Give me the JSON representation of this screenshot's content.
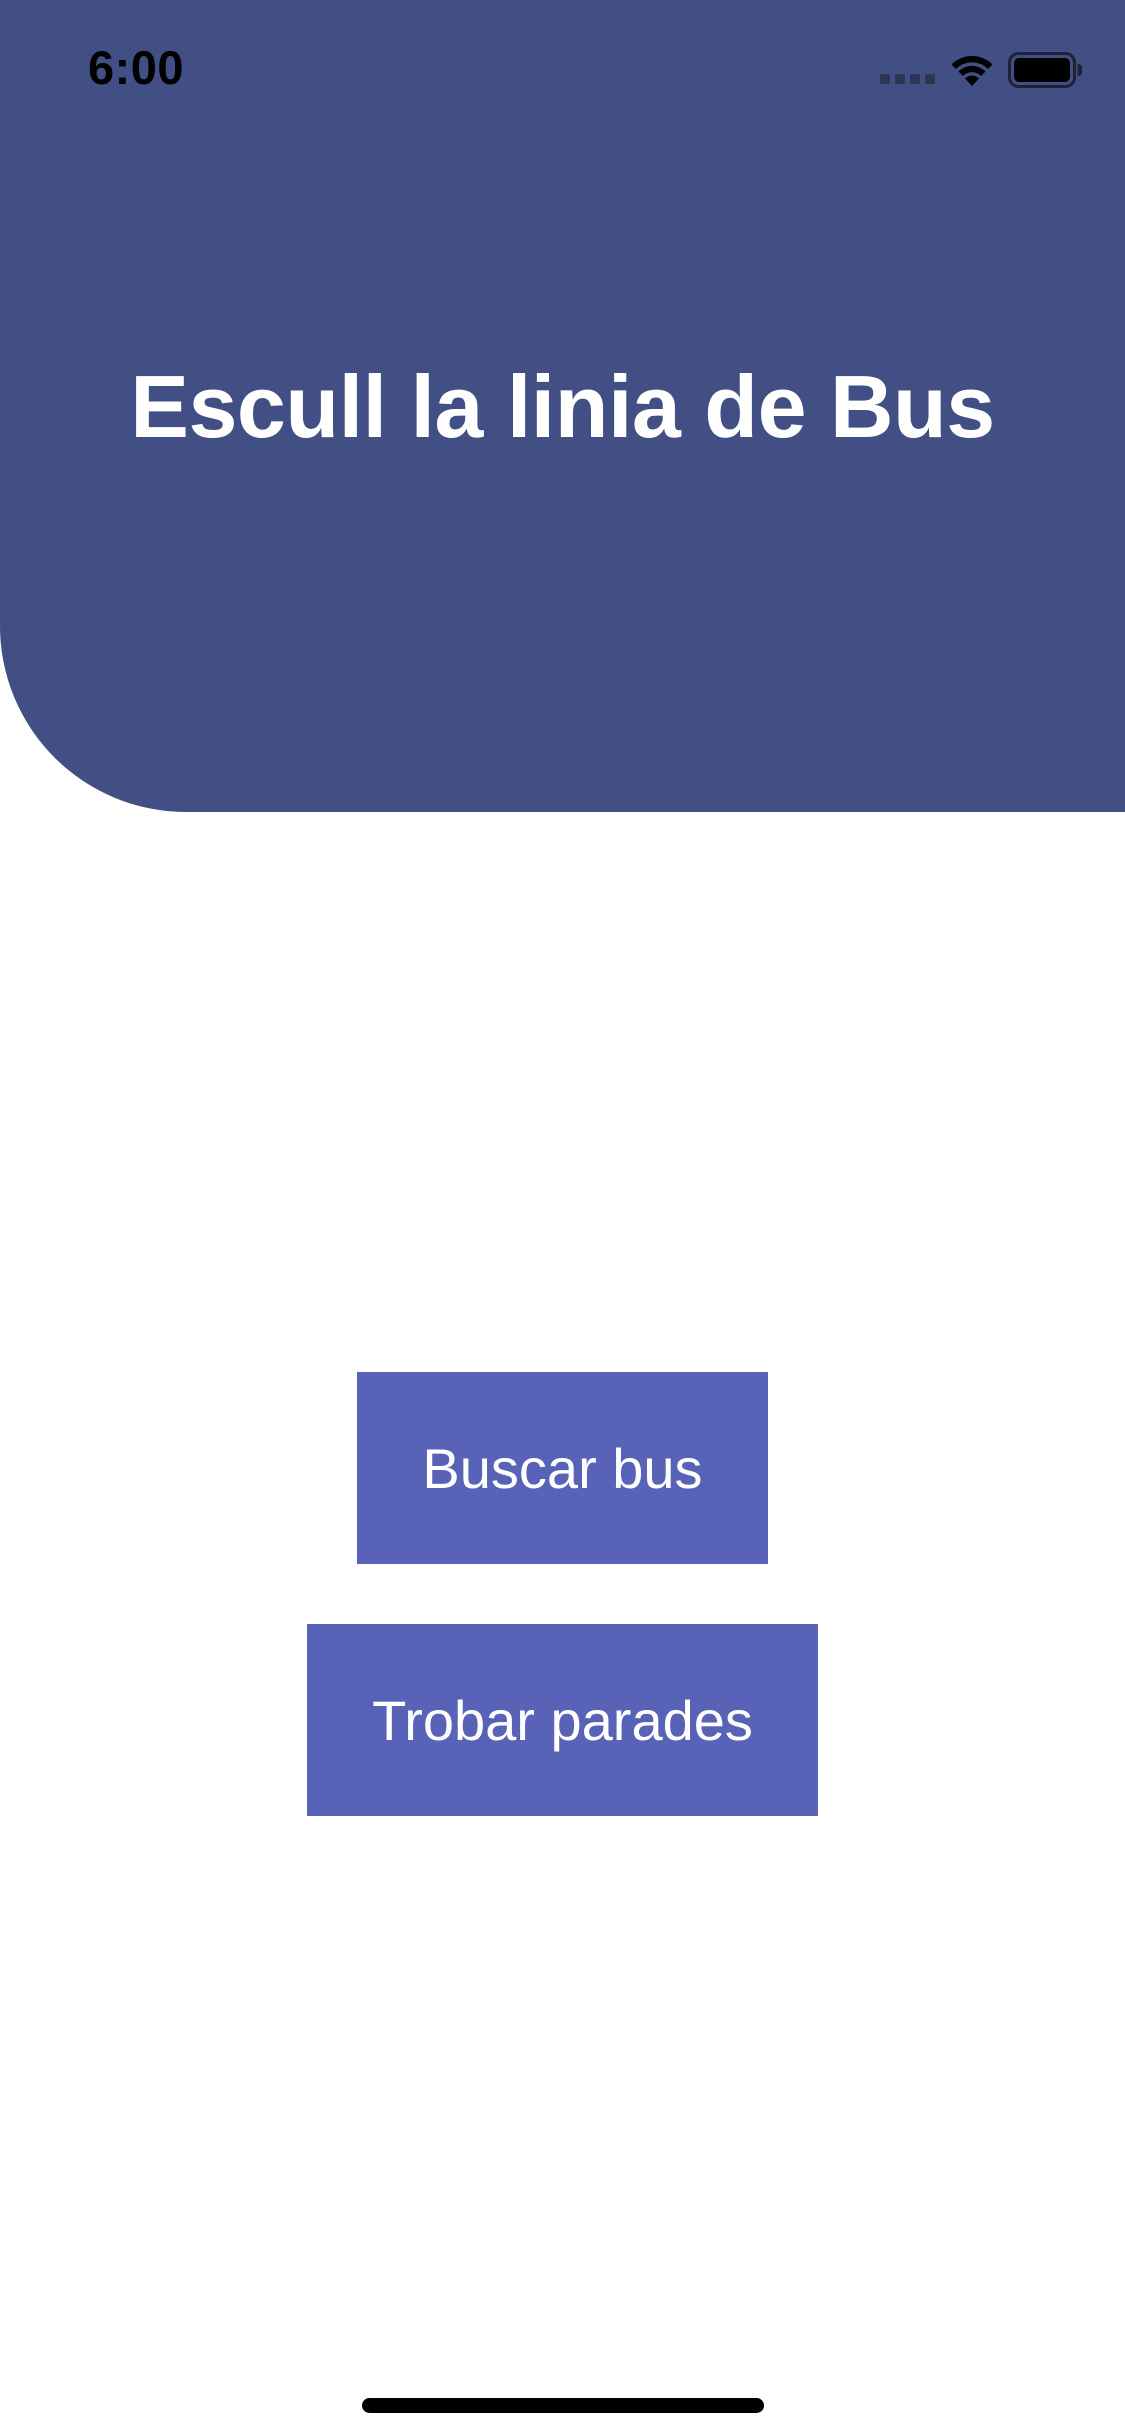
{
  "status_bar": {
    "time": "6:00",
    "signal_icon": "cellular-signal-icon",
    "wifi_icon": "wifi-icon",
    "battery_icon": "battery-icon"
  },
  "header": {
    "title": "Escull la linia de Bus",
    "background_color": "#424f84"
  },
  "actions": {
    "search_bus_label": "Buscar bus",
    "find_stops_label": "Trobar parades",
    "button_color": "#5863b8"
  }
}
